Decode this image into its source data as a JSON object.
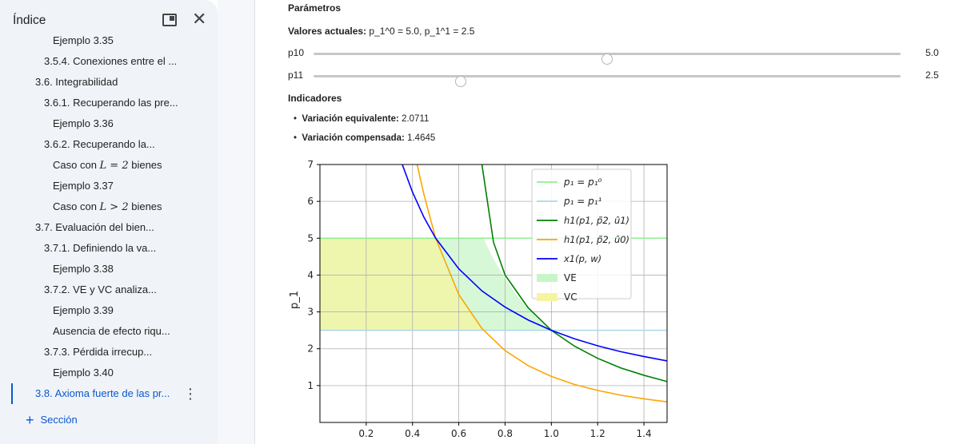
{
  "sidebar": {
    "title": "Índice",
    "items": [
      {
        "label": "Ejemplo 3.35",
        "active": false
      },
      {
        "label": "3.5.4. Conexiones entre el ...",
        "active": false
      },
      {
        "label": "3.6. Integrabilidad",
        "active": false
      },
      {
        "label": "3.6.1. Recuperando las pre...",
        "active": false
      },
      {
        "label": "Ejemplo 3.36",
        "active": false
      },
      {
        "label": "3.6.2. Recuperando la...",
        "active": false
      },
      {
        "label_pre": "Caso con ",
        "math": "L = 2",
        "label_post": " bienes",
        "active": false
      },
      {
        "label": "Ejemplo 3.37",
        "active": false
      },
      {
        "label_pre": "Caso con ",
        "math": "L > 2",
        "label_post": " bienes",
        "active": false
      },
      {
        "label": "3.7. Evaluación del bien...",
        "active": false
      },
      {
        "label": "3.7.1. Definiendo la va...",
        "active": false
      },
      {
        "label": "Ejemplo 3.38",
        "active": false
      },
      {
        "label": "3.7.2. VE y VC analiza...",
        "active": false
      },
      {
        "label": "Ejemplo 3.39",
        "active": false
      },
      {
        "label": "Ausencia de efecto riqu...",
        "active": false
      },
      {
        "label": "3.7.3. Pérdida irrecup...",
        "active": false
      },
      {
        "label": "Ejemplo 3.40",
        "active": false
      },
      {
        "label": "3.8. Axioma fuerte de las pr...",
        "active": true
      }
    ],
    "add_section": "Sección",
    "icons": {
      "window": "dock-window-icon",
      "close": "close-icon",
      "more": "more-vert-icon",
      "add": "plus-icon"
    }
  },
  "params": {
    "title": "Parámetros",
    "current_label": "Valores actuales:",
    "current_value": "p_1^0 = 5.0, p_1^1 = 2.5",
    "sliders": [
      {
        "label": "p10",
        "value": "5.0",
        "fraction": 0.5
      },
      {
        "label": "p11",
        "value": "2.5",
        "fraction": 0.25
      }
    ]
  },
  "indicators": {
    "title": "Indicadores",
    "items": [
      {
        "label": "Variación equivalente:",
        "value": "2.0711"
      },
      {
        "label": "Variación compensada:",
        "value": "1.4645"
      }
    ]
  },
  "chart_data": {
    "type": "line",
    "ylabel": "p_1",
    "xlim": [
      0.0,
      1.5
    ],
    "ylim": [
      0.0,
      7.0
    ],
    "xticks": [
      "0.2",
      "0.4",
      "0.6",
      "0.8",
      "1.0",
      "1.2",
      "1.4"
    ],
    "yticks": [
      "1",
      "2",
      "3",
      "4",
      "5",
      "6",
      "7"
    ],
    "grid": true,
    "legend_position": "top-right",
    "hlines": [
      {
        "name": "p1 = p1^0",
        "y": 5.0,
        "color": "#90ee90"
      },
      {
        "name": "p1 = p1^1",
        "y": 2.5,
        "color": "#add8e6"
      }
    ],
    "series": [
      {
        "name": "h1(p1, p̃2, û1)",
        "color": "#008000",
        "x": [
          0.7,
          0.75,
          0.8,
          0.9,
          1.0,
          1.1,
          1.2,
          1.3,
          1.4,
          1.5
        ],
        "y": [
          7.0,
          4.89,
          4.0,
          3.11,
          2.5,
          2.07,
          1.74,
          1.48,
          1.28,
          1.11
        ]
      },
      {
        "name": "h1(p1, p̃2, û0)",
        "color": "#ffa500",
        "x": [
          0.42,
          0.45,
          0.5,
          0.6,
          0.7,
          0.8,
          0.9,
          1.0,
          1.1,
          1.2,
          1.3,
          1.4,
          1.5
        ],
        "y": [
          7.0,
          6.17,
          5.0,
          3.47,
          2.55,
          1.95,
          1.54,
          1.25,
          1.03,
          0.87,
          0.74,
          0.64,
          0.56
        ]
      },
      {
        "name": "x1(p, w)",
        "color": "#0000ff",
        "x": [
          0.35,
          0.4,
          0.45,
          0.5,
          0.6,
          0.7,
          0.8,
          0.9,
          1.0,
          1.1,
          1.2,
          1.3,
          1.4,
          1.5
        ],
        "y": [
          7.1,
          6.25,
          5.56,
          5.0,
          4.17,
          3.57,
          3.13,
          2.78,
          2.5,
          2.27,
          2.08,
          1.92,
          1.79,
          1.67
        ]
      }
    ],
    "areas": [
      {
        "name": "VE",
        "color": "#c8f5c8"
      },
      {
        "name": "VC",
        "color": "#f5f5a0"
      }
    ]
  }
}
